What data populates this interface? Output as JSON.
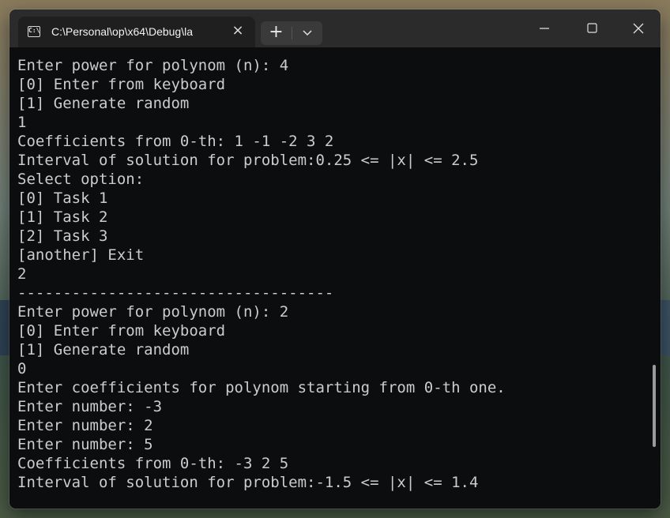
{
  "tab": {
    "title": "C:\\Personal\\op\\x64\\Debug\\la",
    "icon": "terminal-icon",
    "close": "×"
  },
  "toolbar": {
    "new_tab": "+",
    "dropdown_icon": "chevron-down-icon"
  },
  "window_controls": [
    "minimize-icon",
    "maximize-icon",
    "close-icon"
  ],
  "terminal": {
    "lines": [
      "Enter power for polynom (n): 4",
      "[0] Enter from keyboard",
      "[1] Generate random",
      "1",
      "Coefficients from 0-th: 1 -1 -2 3 2",
      "Interval of solution for problem:0.25 <= |x| <= 2.5",
      "Select option:",
      "[0] Task 1",
      "[1] Task 2",
      "[2] Task 3",
      "[another] Exit",
      "2",
      "-----------------------------------",
      "Enter power for polynom (n): 2",
      "[0] Enter from keyboard",
      "[1] Generate random",
      "0",
      "Enter coefficients for polynom starting from 0-th one.",
      "Enter number: -3",
      "Enter number: 2",
      "Enter number: 5",
      "Coefficients from 0-th: -3 2 5",
      "Interval of solution for problem:-1.5 <= |x| <= 1.4"
    ]
  }
}
